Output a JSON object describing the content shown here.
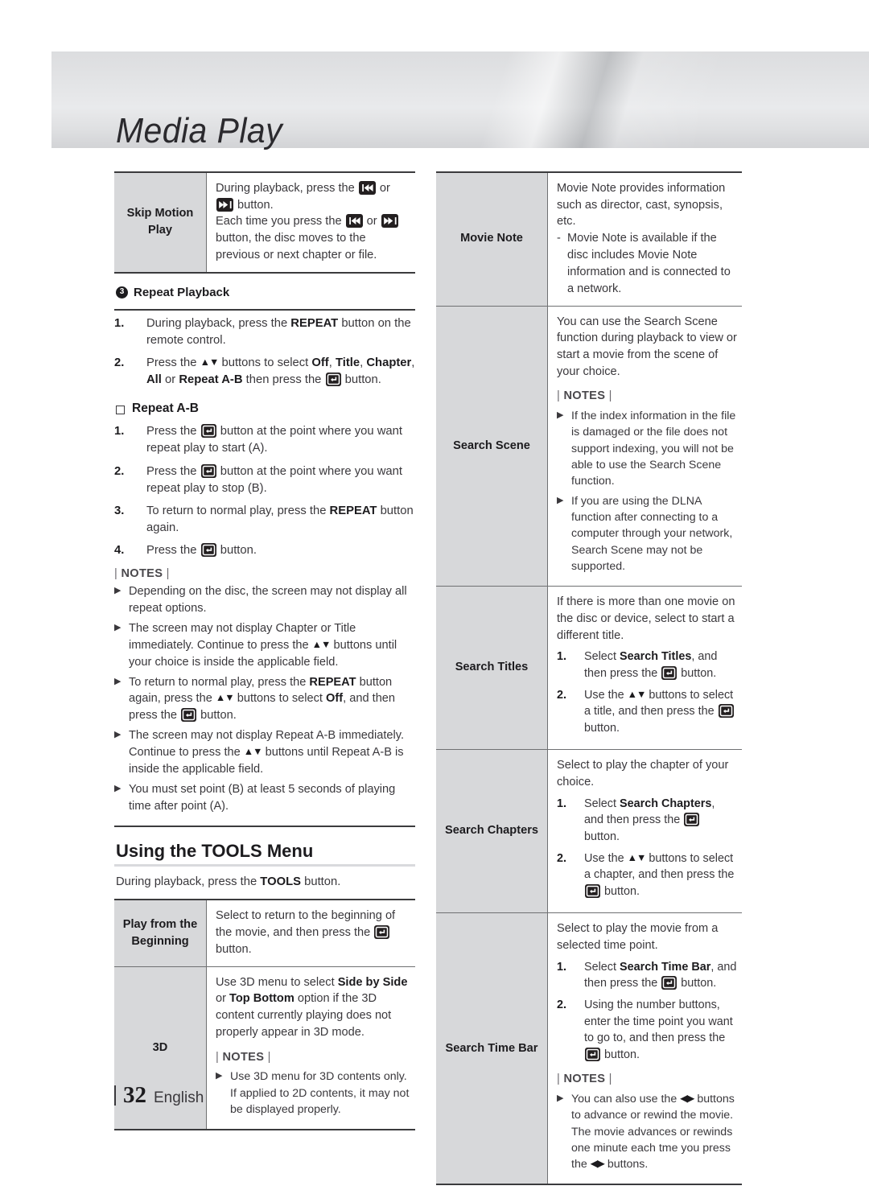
{
  "header": {
    "title": "Media Play"
  },
  "footer": {
    "page_number": "32",
    "language": "English"
  },
  "icons": {
    "enter": "enter-button-icon",
    "skip_back": "skip-backward-icon",
    "skip_forward": "skip-forward-icon",
    "updown": "▲▼",
    "leftright": "◀▶"
  },
  "left_column": {
    "table_skip": {
      "rows": [
        {
          "label": "Skip Motion Play",
          "body_segments": [
            {
              "t": "During playback, press the "
            },
            {
              "icon": "skip_back"
            },
            {
              "t": " or "
            },
            {
              "icon": "skip_forward"
            },
            {
              "t": " button."
            },
            {
              "br": true
            },
            {
              "t": "Each time you press the "
            },
            {
              "icon": "skip_back"
            },
            {
              "t": " or "
            },
            {
              "icon": "skip_forward"
            },
            {
              "t": " button, the disc moves to the previous or next chapter or file."
            }
          ]
        }
      ]
    },
    "repeat_playback": {
      "number": "3",
      "heading": "Repeat Playback",
      "steps": [
        {
          "n": "1.",
          "segments": [
            {
              "t": "During playback, press the "
            },
            {
              "b": "REPEAT"
            },
            {
              "t": " button on the remote control."
            }
          ]
        },
        {
          "n": "2.",
          "segments": [
            {
              "t": "Press the "
            },
            {
              "arrows": "updown"
            },
            {
              "t": " buttons to select "
            },
            {
              "b": "Off"
            },
            {
              "t": ", "
            },
            {
              "b": "Title"
            },
            {
              "t": ", "
            },
            {
              "b": "Chapter"
            },
            {
              "t": ", "
            },
            {
              "b": "All"
            },
            {
              "t": " or "
            },
            {
              "b": "Repeat A-B"
            },
            {
              "t": " then press the "
            },
            {
              "icon": "enter"
            },
            {
              "t": " button."
            }
          ]
        }
      ]
    },
    "repeat_ab": {
      "heading": "Repeat A-B",
      "steps": [
        {
          "n": "1.",
          "segments": [
            {
              "t": "Press the "
            },
            {
              "icon": "enter"
            },
            {
              "t": " button at the point where you want repeat play to start (A)."
            }
          ]
        },
        {
          "n": "2.",
          "segments": [
            {
              "t": "Press the "
            },
            {
              "icon": "enter"
            },
            {
              "t": " button at the point where you want repeat play to stop (B)."
            }
          ]
        },
        {
          "n": "3.",
          "segments": [
            {
              "t": "To return to normal play, press the "
            },
            {
              "b": "REPEAT"
            },
            {
              "t": " button again."
            }
          ]
        },
        {
          "n": "4.",
          "segments": [
            {
              "t": "Press the "
            },
            {
              "icon": "enter"
            },
            {
              "t": " button."
            }
          ]
        }
      ]
    },
    "notes_heading": "NOTES",
    "notes": [
      [
        {
          "t": "Depending on the disc, the screen may not display all repeat options."
        }
      ],
      [
        {
          "t": "The screen may not display Chapter or Title immediately. Continue to press the "
        },
        {
          "arrows": "updown"
        },
        {
          "t": " buttons until your choice is inside the applicable field."
        }
      ],
      [
        {
          "t": "To return to normal play, press the "
        },
        {
          "b": "REPEAT"
        },
        {
          "t": " button again, press the "
        },
        {
          "arrows": "updown"
        },
        {
          "t": " buttons to select "
        },
        {
          "b": "Off"
        },
        {
          "t": ", and then press the "
        },
        {
          "icon": "enter"
        },
        {
          "t": " button."
        }
      ],
      [
        {
          "t": "The screen may not display Repeat A-B immediately. Continue to press the "
        },
        {
          "arrows": "updown"
        },
        {
          "t": " buttons until Repeat A-B is inside the applicable field."
        }
      ],
      [
        {
          "t": "You must set point (B) at least 5 seconds of playing time after point (A)."
        }
      ]
    ],
    "tools_section": {
      "title": "Using the TOOLS Menu",
      "intro_segments": [
        {
          "t": "During playback, press the "
        },
        {
          "b": "TOOLS"
        },
        {
          "t": " button."
        }
      ],
      "rows": [
        {
          "label": "Play from the Beginning",
          "body_segments": [
            {
              "t": "Select to return to the beginning of the movie, and then press the "
            },
            {
              "icon": "enter"
            },
            {
              "t": " button."
            }
          ]
        },
        {
          "label": "3D",
          "body_segments": [
            {
              "t": "Use 3D menu to select "
            },
            {
              "b": "Side by Side"
            },
            {
              "t": " or "
            },
            {
              "b": "Top Bottom"
            },
            {
              "t": " option if the 3D content currently playing does not properly appear in 3D mode."
            }
          ],
          "notes_heading": "NOTES",
          "notes": [
            [
              {
                "t": "Use 3D menu for 3D contents only. If applied to 2D contents, it may not be displayed properly."
              }
            ]
          ]
        }
      ]
    }
  },
  "right_column": {
    "rows": [
      {
        "label": "Movie Note",
        "body_segments": [
          {
            "t": "Movie Note provides information such as director, cast, synopsis, etc."
          }
        ],
        "dashes": [
          [
            {
              "t": "Movie Note is available if the disc includes Movie Note information and is connected to a network."
            }
          ]
        ]
      },
      {
        "label": "Search Scene",
        "body_segments": [
          {
            "t": "You can use the Search Scene function during playback to view or start a movie from the scene of your choice."
          }
        ],
        "notes_heading": "NOTES",
        "notes": [
          [
            {
              "t": "If the index information in the file is damaged or the file does not support indexing, you will not be able to use the Search Scene function."
            }
          ],
          [
            {
              "t": "If you are using the DLNA function after connecting to a computer through your network, Search Scene may not be supported."
            }
          ]
        ]
      },
      {
        "label": "Search Titles",
        "body_segments": [
          {
            "t": "If there is more than one movie on the disc or device, select to start a different title."
          }
        ],
        "steps": [
          {
            "n": "1.",
            "segments": [
              {
                "t": "Select "
              },
              {
                "b": "Search Titles"
              },
              {
                "t": ", and then press the "
              },
              {
                "icon": "enter"
              },
              {
                "t": " button."
              }
            ]
          },
          {
            "n": "2.",
            "segments": [
              {
                "t": "Use the "
              },
              {
                "arrows": "updown"
              },
              {
                "t": " buttons to select a title, and then press the "
              },
              {
                "icon": "enter"
              },
              {
                "t": " button."
              }
            ]
          }
        ]
      },
      {
        "label": "Search Chapters",
        "body_segments": [
          {
            "t": "Select to play the chapter of your choice."
          }
        ],
        "steps": [
          {
            "n": "1.",
            "segments": [
              {
                "t": "Select "
              },
              {
                "b": "Search Chapters"
              },
              {
                "t": ", and then press the "
              },
              {
                "icon": "enter"
              },
              {
                "t": " button."
              }
            ]
          },
          {
            "n": "2.",
            "segments": [
              {
                "t": "Use the "
              },
              {
                "arrows": "updown"
              },
              {
                "t": " buttons to select a chapter, and then press the "
              },
              {
                "icon": "enter"
              },
              {
                "t": " button."
              }
            ]
          }
        ]
      },
      {
        "label": "Search Time Bar",
        "body_segments": [
          {
            "t": "Select to play the movie from a selected time point."
          }
        ],
        "steps": [
          {
            "n": "1.",
            "segments": [
              {
                "t": "Select "
              },
              {
                "b": "Search Time Bar"
              },
              {
                "t": ", and then press the "
              },
              {
                "icon": "enter"
              },
              {
                "t": " button."
              }
            ]
          },
          {
            "n": "2.",
            "segments": [
              {
                "t": "Using the number buttons, enter the time point you want to go to, and then press the "
              },
              {
                "icon": "enter"
              },
              {
                "t": " button."
              }
            ]
          }
        ],
        "notes_heading": "NOTES",
        "notes": [
          [
            {
              "t": "You can also use the "
            },
            {
              "arrows": "leftright"
            },
            {
              "t": " buttons to advance or rewind the movie. The movie advances or rewinds one minute each tme you press the "
            },
            {
              "arrows": "leftright"
            },
            {
              "t": " buttons."
            }
          ]
        ]
      }
    ]
  }
}
